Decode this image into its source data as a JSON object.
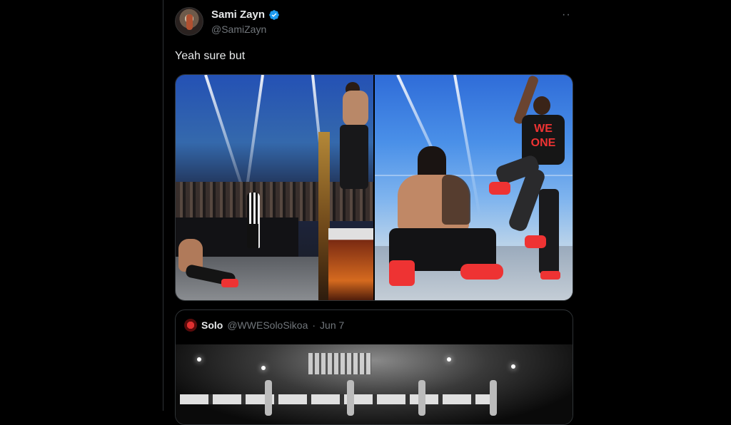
{
  "tweet": {
    "author_name": "Sami Zayn",
    "author_handle": "@SamiZayn",
    "verified": true,
    "text": "Yeah sure but",
    "more_icon": "more-horizontal-icon",
    "media": [
      {
        "description_icon": "photo"
      },
      {
        "description_icon": "photo",
        "shirt_text": "WE\nONE"
      }
    ]
  },
  "quoted_tweet": {
    "author_name": "Solo",
    "author_handle": "@WWESoloSikoa",
    "separator": "·",
    "date": "Jun 7"
  },
  "colors": {
    "background": "#000000",
    "text_primary": "#e7e9ea",
    "text_secondary": "#71767b",
    "border": "#2f3336",
    "verified_blue": "#1d9bf0"
  }
}
